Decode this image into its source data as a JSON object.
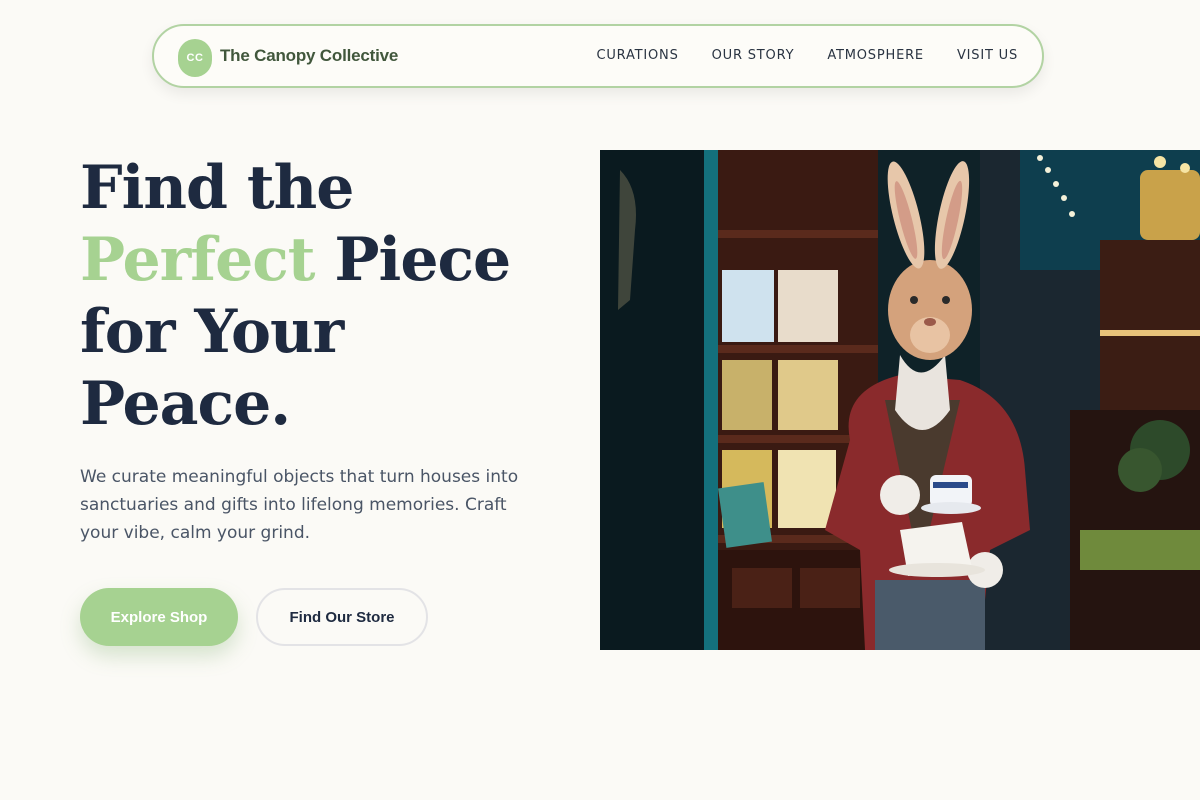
{
  "nav": {
    "logo_initials": "CC",
    "brand": "The Canopy Collective",
    "links": [
      "CURATIONS",
      "OUR STORY",
      "ATMOSPHERE",
      "VISIT US"
    ]
  },
  "hero": {
    "headline_line1": "Find the",
    "headline_accent": "Perfect",
    "headline_line2_rest": " Piece",
    "headline_line3": "for Your",
    "headline_line4": "Peace.",
    "subtext": "We curate meaningful objects that turn houses into sanctuaries and gifts into lifelong memories. Craft your vibe, calm your grind.",
    "primary_button": "Explore Shop",
    "secondary_button": "Find Our Store"
  },
  "colors": {
    "accent": "#a6d291",
    "heading": "#1e2a40",
    "body_text": "#4a5566",
    "background": "#fbfaf6"
  }
}
